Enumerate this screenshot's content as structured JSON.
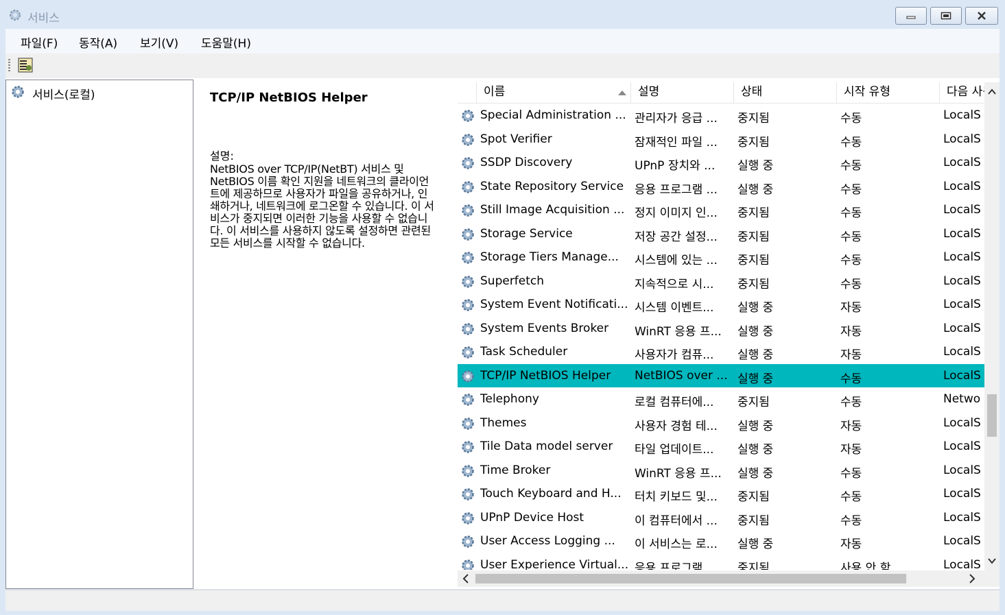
{
  "window": {
    "title": "서비스"
  },
  "menu": [
    {
      "label": "파일(F)"
    },
    {
      "label": "동작(A)"
    },
    {
      "label": "보기(V)"
    },
    {
      "label": "도움말(H)"
    }
  ],
  "tree": {
    "root_label": "서비스(로컬)"
  },
  "details": {
    "service_name": "TCP/IP NetBIOS Helper",
    "desc_label": "설명:",
    "desc_text": "NetBIOS over TCP/IP(NetBT) 서비스 및 NetBIOS 이름 확인 지원을 네트워크의 클라이언트에 제공하므로 사용자가 파일을 공유하거나, 인쇄하거나, 네트워크에 로그온할 수 있습니다. 이 서비스가 중지되면 이러한 기능을 사용할 수 없습니다. 이 서비스를 사용하지 않도록 설정하면 관련된 모든 서비스를 시작할 수 없습니다."
  },
  "columns": [
    {
      "label": "이름"
    },
    {
      "label": "설명"
    },
    {
      "label": "상태"
    },
    {
      "label": "시작 유형"
    },
    {
      "label": "다음 사용자로 로그온"
    }
  ],
  "rows": [
    {
      "name": "Special Administration ...",
      "desc": "관리자가 응급 ...",
      "status": "중지됨",
      "start": "수동",
      "logon": "LocalS"
    },
    {
      "name": "Spot Verifier",
      "desc": "잠재적인 파일 ...",
      "status": "중지됨",
      "start": "수동",
      "logon": "LocalS"
    },
    {
      "name": "SSDP Discovery",
      "desc": "UPnP 장치와 ...",
      "status": "실행 중",
      "start": "수동",
      "logon": "LocalS"
    },
    {
      "name": "State Repository Service",
      "desc": "응용 프로그램 ...",
      "status": "실행 중",
      "start": "수동",
      "logon": "LocalS"
    },
    {
      "name": "Still Image Acquisition ...",
      "desc": "정지 이미지 인...",
      "status": "중지됨",
      "start": "수동",
      "logon": "LocalS"
    },
    {
      "name": "Storage Service",
      "desc": "저장 공간 설정...",
      "status": "중지됨",
      "start": "수동",
      "logon": "LocalS"
    },
    {
      "name": "Storage Tiers Manage...",
      "desc": "시스템에 있는 ...",
      "status": "중지됨",
      "start": "수동",
      "logon": "LocalS"
    },
    {
      "name": "Superfetch",
      "desc": "지속적으로 시...",
      "status": "중지됨",
      "start": "수동",
      "logon": "LocalS"
    },
    {
      "name": "System Event Notificati...",
      "desc": "시스템 이벤트...",
      "status": "실행 중",
      "start": "자동",
      "logon": "LocalS"
    },
    {
      "name": "System Events Broker",
      "desc": "WinRT 응용 프...",
      "status": "실행 중",
      "start": "자동",
      "logon": "LocalS"
    },
    {
      "name": "Task Scheduler",
      "desc": "사용자가 컴퓨...",
      "status": "실행 중",
      "start": "자동",
      "logon": "LocalS"
    },
    {
      "name": "TCP/IP NetBIOS Helper",
      "desc": "NetBIOS over ...",
      "status": "실행 중",
      "start": "수동",
      "logon": "LocalS",
      "selected": true
    },
    {
      "name": "Telephony",
      "desc": "로컬 컴퓨터에...",
      "status": "중지됨",
      "start": "수동",
      "logon": "Netwo"
    },
    {
      "name": "Themes",
      "desc": "사용자 경험 테...",
      "status": "실행 중",
      "start": "자동",
      "logon": "LocalS"
    },
    {
      "name": "Tile Data model server",
      "desc": "타일 업데이트...",
      "status": "실행 중",
      "start": "자동",
      "logon": "LocalS"
    },
    {
      "name": "Time Broker",
      "desc": "WinRT 응용 프...",
      "status": "실행 중",
      "start": "수동",
      "logon": "LocalS"
    },
    {
      "name": "Touch Keyboard and H...",
      "desc": "터치 키보드 및...",
      "status": "중지됨",
      "start": "수동",
      "logon": "LocalS"
    },
    {
      "name": "UPnP Device Host",
      "desc": "이 컴퓨터에서 ...",
      "status": "중지됨",
      "start": "수동",
      "logon": "LocalS"
    },
    {
      "name": "User Access Logging ...",
      "desc": "이 서비스는 로...",
      "status": "실행 중",
      "start": "자동",
      "logon": "LocalS"
    },
    {
      "name": "User Experience Virtual...",
      "desc": "응용 프로그램 ...",
      "status": "중지됨",
      "start": "사용 안 함",
      "logon": "LocalS"
    }
  ],
  "colors": {
    "selection": "#00b7bd",
    "chrome": "#dbe7f5"
  }
}
